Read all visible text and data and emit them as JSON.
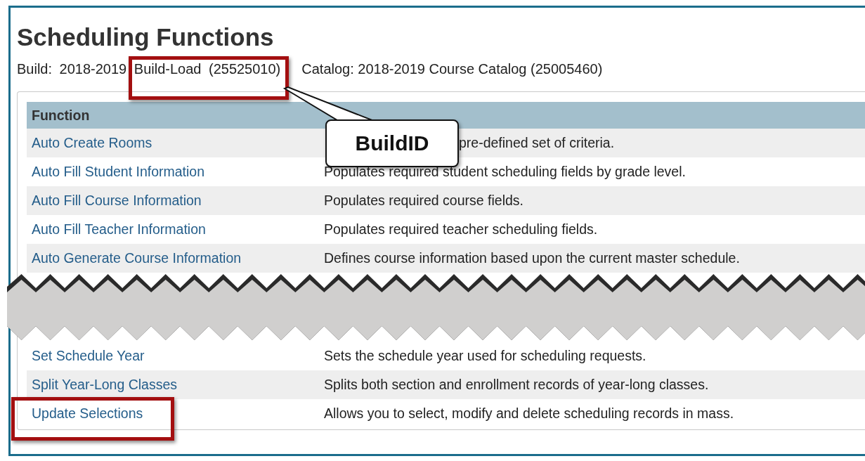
{
  "title": "Scheduling Functions",
  "build_line": {
    "build": "Build: 2018-2019 Build-Load (25525010)",
    "catalog": "Catalog: 2018-2019 Course Catalog (25005460)"
  },
  "table": {
    "columns": [
      "Function"
    ],
    "rows_top": [
      {
        "function": "Auto Create Rooms",
        "description": "pre-defined set of criteria.",
        "occluded": true
      },
      {
        "function": "Auto Fill Student Information",
        "description": "Populates required student scheduling fields by grade level."
      },
      {
        "function": "Auto Fill Course Information",
        "description": "Populates required course fields."
      },
      {
        "function": "Auto Fill Teacher Information",
        "description": "Populates required teacher scheduling fields."
      },
      {
        "function": "Auto Generate Course Information",
        "description": "Defines course information based upon the current master schedule."
      }
    ],
    "rows_bottom": [
      {
        "function": "Set Schedule Year",
        "description": "Sets the schedule year used for scheduling requests."
      },
      {
        "function": "Split Year-Long Classes",
        "description": "Splits both section and enrollment records of year-long classes."
      },
      {
        "function": "Update Selections",
        "description": "Allows you to select, modify and delete scheduling records in mass."
      }
    ]
  },
  "callout": {
    "text": "BuildID"
  }
}
